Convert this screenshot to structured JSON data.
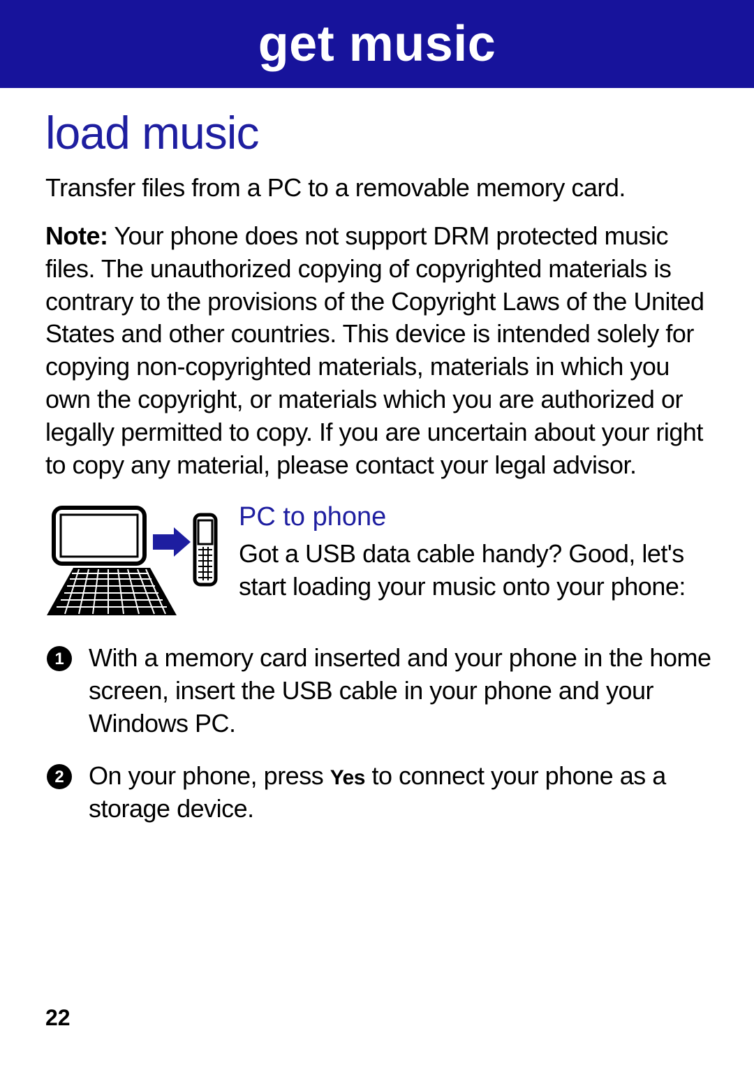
{
  "banner": {
    "title": "get music"
  },
  "section": {
    "title": "load music"
  },
  "intro": "Transfer files from a PC to a removable memory card.",
  "note": {
    "label": "Note:",
    "body": " Your phone does not support DRM protected music files. The unauthorized copying of copyrighted materials is contrary to the provisions of the Copyright Laws of the United States and other countries. This device is intended solely for copying non-copyrighted materials, materials in which you own the copyright, or materials which you are authorized or legally permitted to copy. If you are uncertain about your right to copy any material, please contact your legal advisor."
  },
  "subsection": {
    "title": "PC to phone",
    "body": "Got a USB data cable handy? Good, let's start loading your music onto your phone:"
  },
  "steps": [
    {
      "num": "1",
      "text": "With a memory card inserted and your phone in the home screen, insert the USB cable in your phone and your Windows PC."
    },
    {
      "num": "2",
      "text_before": "On your phone, press ",
      "ui_key": "Yes",
      "text_after": " to connect your phone as a storage device."
    }
  ],
  "page_number": "22"
}
